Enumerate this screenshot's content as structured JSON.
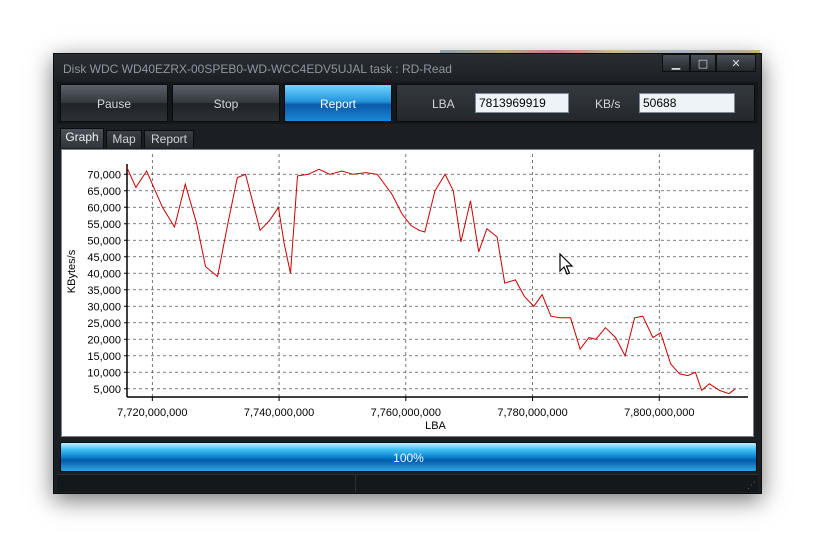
{
  "window": {
    "title": "Disk WDC WD40EZRX-00SPEB0-WD-WCC4EDV5UJAL   task : RD-Read",
    "minimize": "▁",
    "maximize": "□",
    "close": "✕"
  },
  "toolbar": {
    "pause_label": "Pause",
    "stop_label": "Stop",
    "report_label": "Report",
    "lba_label": "LBA",
    "lba_value": "7813969919",
    "kbs_label": "KB/s",
    "kbs_value": "50688"
  },
  "tabs": [
    {
      "label": "Graph",
      "active": true
    },
    {
      "label": "Map",
      "active": false
    },
    {
      "label": "Report",
      "active": false
    }
  ],
  "progress": {
    "value": 1.0,
    "text": "100%"
  },
  "chart_data": {
    "type": "line",
    "xlabel": "LBA",
    "ylabel": "KBytes/s",
    "xlim": [
      7716000000,
      7814000000
    ],
    "ylim": [
      2500,
      72500
    ],
    "x_ticks": [
      7720000000,
      7740000000,
      7760000000,
      7780000000,
      7800000000
    ],
    "x_tick_labels": [
      "7,720,000,000",
      "7,740,000,000",
      "7,760,000,000",
      "7,780,000,000",
      "7,800,000,000"
    ],
    "y_ticks": [
      5000,
      10000,
      15000,
      20000,
      25000,
      30000,
      35000,
      40000,
      45000,
      50000,
      55000,
      60000,
      65000,
      70000
    ],
    "y_tick_labels": [
      "5,000",
      "10,000",
      "15,000",
      "20,000",
      "25,000",
      "30,000",
      "35,000",
      "40,000",
      "45,000",
      "50,000",
      "55,000",
      "60,000",
      "65,000",
      "70,000"
    ],
    "grid": true,
    "line_color": "#cc0000",
    "series": [
      {
        "x": [
          7716000000,
          7717400000,
          7719100000,
          7721600000,
          7723500000,
          7725200000,
          7727000000,
          7728400000,
          7730300000,
          7731900000,
          7733400000,
          7734700000,
          7737000000,
          7738500000,
          7739900000,
          7740800000,
          7741800000,
          7742900000,
          7744600000,
          7746300000,
          7748000000,
          7749900000,
          7751700000,
          7753700000,
          7755500000,
          7757800000,
          7759400000,
          7760800000,
          7762100000,
          7763000000,
          7764600000,
          7766200000,
          7767500000,
          7768700000,
          7770200000,
          7771500000,
          7772800000,
          7774400000,
          7775600000,
          7777300000,
          7778700000,
          7780200000,
          7781500000,
          7782900000,
          7784300000,
          7786000000,
          7787500000,
          7788900000,
          7790000000,
          7791500000,
          7793100000,
          7794600000,
          7796100000,
          7797400000,
          7799000000,
          7800200000,
          7801800000,
          7803200000,
          7804500000,
          7805700000,
          7806700000,
          7807900000,
          7809500000,
          7811000000,
          7812000000
        ],
        "y": [
          72000,
          66000,
          71000,
          60000,
          54000,
          67000,
          55000,
          42000,
          39000,
          55000,
          69000,
          70000,
          53000,
          56000,
          60000,
          49000,
          40000,
          69500,
          70000,
          71500,
          70000,
          71000,
          70000,
          70500,
          70000,
          64000,
          58000,
          54500,
          53000,
          52500,
          65000,
          70000,
          65000,
          49500,
          62000,
          46500,
          53500,
          51000,
          37000,
          38000,
          33000,
          30000,
          33500,
          27000,
          26500,
          26500,
          17000,
          20500,
          20000,
          23500,
          20500,
          15000,
          26500,
          27000,
          20500,
          22000,
          12500,
          9500,
          9000,
          10000,
          4500,
          6500,
          4500,
          3500,
          5000
        ]
      }
    ]
  }
}
